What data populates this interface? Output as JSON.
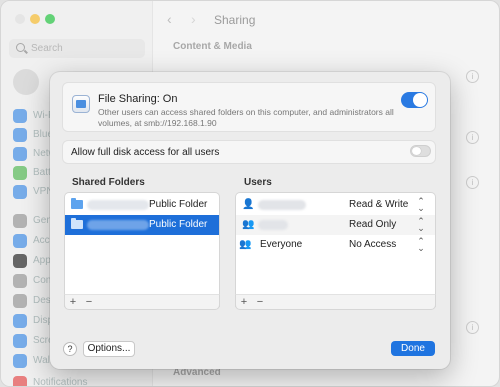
{
  "window": {
    "title": "Sharing",
    "search_placeholder": "Search",
    "section_top": "Content & Media",
    "section_bottom": "Advanced",
    "sidebar_items": [
      {
        "label": "Wi-Fi",
        "color": "#4a90e2"
      },
      {
        "label": "Blue",
        "color": "#4a90e2"
      },
      {
        "label": "Netw",
        "color": "#4a90e2"
      },
      {
        "label": "Batte",
        "color": "#5cb85c"
      },
      {
        "label": "VPN",
        "color": "#4a90e2"
      },
      {
        "label": "Gene",
        "color": "#9a9a9a"
      },
      {
        "label": "Acce",
        "color": "#4a90e2"
      },
      {
        "label": "Appe",
        "color": "#333333"
      },
      {
        "label": "Cont",
        "color": "#9a9a9a"
      },
      {
        "label": "Desk",
        "color": "#9a9a9a"
      },
      {
        "label": "Displ",
        "color": "#4a90e2"
      },
      {
        "label": "Scre",
        "color": "#4a90e2"
      },
      {
        "label": "Wall",
        "color": "#4a90e2"
      },
      {
        "label": "Notifications",
        "color": "#e05555"
      }
    ]
  },
  "sheet": {
    "file_sharing": {
      "title": "File Sharing: On",
      "description": "Other users can access shared folders on this computer, and administrators all volumes, at smb://192.168.1.90",
      "enabled": true
    },
    "full_disk": {
      "label": "Allow full disk access for all users",
      "enabled": false
    },
    "shared_folders": {
      "header": "Shared Folders",
      "items": [
        {
          "name": "Public Folder",
          "selected": false
        },
        {
          "name": "Public Folder",
          "selected": true
        }
      ],
      "add": "+",
      "remove": "−"
    },
    "users": {
      "header": "Users",
      "items": [
        {
          "icon": "user-icon",
          "name": "",
          "permission": "Read & Write"
        },
        {
          "icon": "group-icon",
          "name": "",
          "permission": "Read Only"
        },
        {
          "icon": "everyone-icon",
          "name": "Everyone",
          "permission": "No Access"
        }
      ],
      "add": "+",
      "remove": "−"
    },
    "help_label": "?",
    "options_label": "Options...",
    "done_label": "Done"
  },
  "colors": {
    "accent": "#1f74e0",
    "selection": "#1e6fd9"
  }
}
